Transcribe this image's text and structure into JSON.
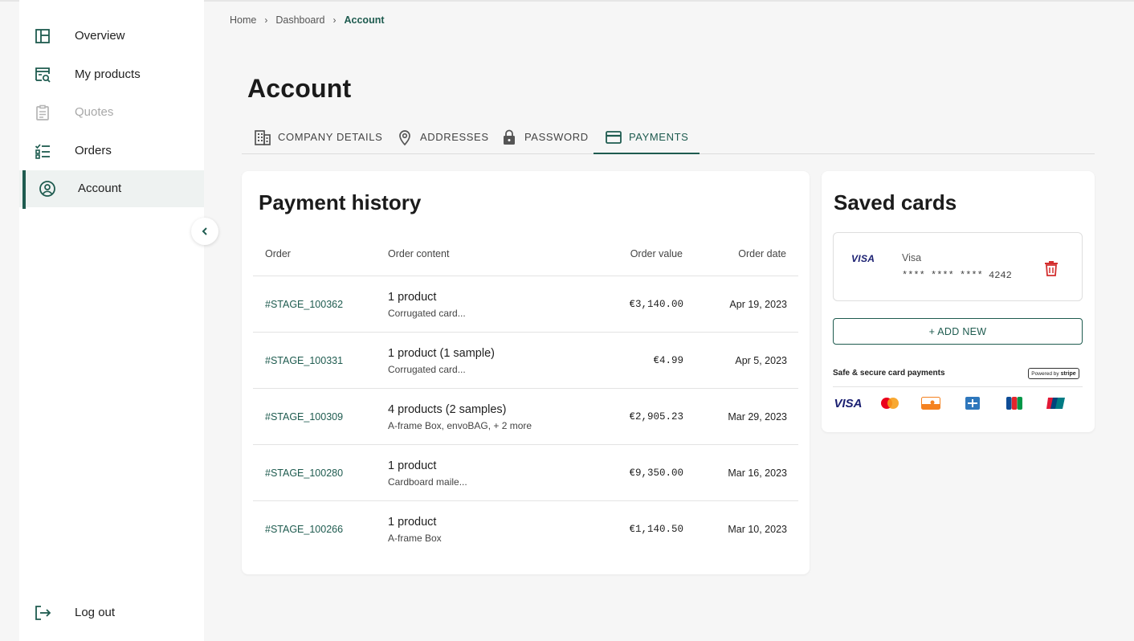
{
  "colors": {
    "accent": "#1e5b4f",
    "danger": "#d32f2f",
    "disabled": "#a8a8a8"
  },
  "sidebar": {
    "items": [
      {
        "label": "Overview",
        "icon": "dashboard-layout-icon",
        "state": "normal"
      },
      {
        "label": "My products",
        "icon": "product-search-icon",
        "state": "normal"
      },
      {
        "label": "Quotes",
        "icon": "document-icon",
        "state": "disabled"
      },
      {
        "label": "Orders",
        "icon": "checklist-icon",
        "state": "normal"
      },
      {
        "label": "Account",
        "icon": "user-circle-icon",
        "state": "active"
      }
    ],
    "logout_label": "Log out"
  },
  "breadcrumb": {
    "home": "Home",
    "dashboard": "Dashboard",
    "current": "Account"
  },
  "page": {
    "title": "Account"
  },
  "tabs": [
    {
      "label": "COMPANY DETAILS",
      "icon": "building-icon"
    },
    {
      "label": "ADDRESSES",
      "icon": "location-pin-icon"
    },
    {
      "label": "PASSWORD",
      "icon": "lock-icon"
    },
    {
      "label": "PAYMENTS",
      "icon": "credit-card-icon",
      "active": true
    }
  ],
  "payment_history": {
    "title": "Payment history",
    "columns": {
      "order": "Order",
      "content": "Order content",
      "value": "Order value",
      "date": "Order date"
    },
    "rows": [
      {
        "order": "#STAGE_100362",
        "content": "1 product",
        "detail": "Corrugated card...",
        "value": "€3,140.00",
        "date": "Apr 19, 2023"
      },
      {
        "order": "#STAGE_100331",
        "content": "1 product (1 sample)",
        "detail": "Corrugated card...",
        "value": "€4.99",
        "date": "Apr 5, 2023"
      },
      {
        "order": "#STAGE_100309",
        "content": "4 products (2 samples)",
        "detail": "A-frame Box, envoBAG, + 2 more",
        "value": "€2,905.23",
        "date": "Mar 29, 2023"
      },
      {
        "order": "#STAGE_100280",
        "content": "1 product",
        "detail": "Cardboard maile...",
        "value": "€9,350.00",
        "date": "Mar 16, 2023"
      },
      {
        "order": "#STAGE_100266",
        "content": "1 product",
        "detail": "A-frame Box",
        "value": "€1,140.50",
        "date": "Mar 10, 2023"
      }
    ]
  },
  "saved_cards": {
    "title": "Saved cards",
    "card": {
      "logo": "VISA",
      "brand": "Visa",
      "number": "**** **** **** 4242"
    },
    "add_label": "+ ADD NEW",
    "secure_text": "Safe & secure card payments",
    "powered_by": "Powered by",
    "stripe": "stripe",
    "visa_logo": "VISA",
    "payment_logos": [
      "visa-logo",
      "mastercard-logo",
      "discover-logo",
      "amex-logo",
      "jcb-logo",
      "unionpay-logo"
    ]
  }
}
